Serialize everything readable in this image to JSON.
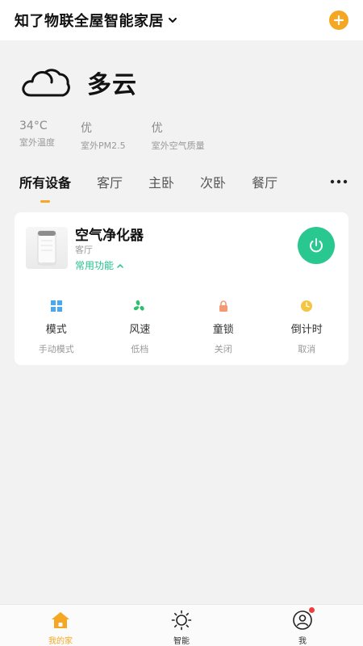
{
  "header": {
    "home_title": "知了物联全屋智能家居",
    "add_icon": "plus-icon",
    "accent_color": "#f5a623"
  },
  "weather": {
    "condition": "多云",
    "icon": "cloudy-icon",
    "metrics": [
      {
        "value": "34°C",
        "label": "室外温度"
      },
      {
        "value": "优",
        "label": "室外PM2.5"
      },
      {
        "value": "优",
        "label": "室外空气质量"
      }
    ]
  },
  "tabs": [
    {
      "label": "所有设备",
      "active": true
    },
    {
      "label": "客厅"
    },
    {
      "label": "主卧"
    },
    {
      "label": "次卧"
    },
    {
      "label": "餐厅"
    }
  ],
  "device": {
    "name": "空气净化器",
    "room": "客厅",
    "quick_label": "常用功能",
    "power_color": "#28c890",
    "functions": [
      {
        "icon": "grid-mode-icon",
        "label": "模式",
        "value": "手动模式",
        "color": "#4aa8f0"
      },
      {
        "icon": "fan-icon",
        "label": "风速",
        "value": "低档",
        "color": "#2fbf6f"
      },
      {
        "icon": "lock-icon",
        "label": "童锁",
        "value": "关闭",
        "color": "#f49a73"
      },
      {
        "icon": "timer-icon",
        "label": "倒计时",
        "value": "取消",
        "color": "#f5c542"
      }
    ]
  },
  "nav": [
    {
      "label": "我的家",
      "icon": "home-icon",
      "active": true
    },
    {
      "label": "智能",
      "icon": "sun-icon"
    },
    {
      "label": "我",
      "icon": "user-icon"
    }
  ]
}
